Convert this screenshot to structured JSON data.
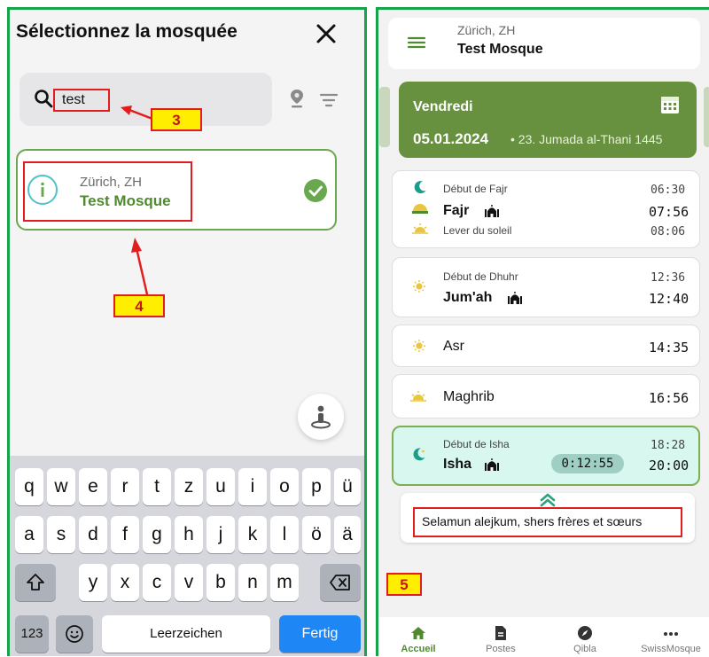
{
  "left": {
    "title": "Sélectionnez la mosquée",
    "search": {
      "value": "test"
    },
    "result": {
      "city": "Zürich, ZH",
      "name": "Test Mosque"
    },
    "keyboard": {
      "row1": [
        "q",
        "w",
        "e",
        "r",
        "t",
        "z",
        "u",
        "i",
        "o",
        "p",
        "ü"
      ],
      "row2": [
        "a",
        "s",
        "d",
        "f",
        "g",
        "h",
        "j",
        "k",
        "l",
        "ö",
        "ä"
      ],
      "row3": [
        "y",
        "x",
        "c",
        "v",
        "b",
        "n",
        "m"
      ],
      "numbers_key": "123",
      "space_key": "Leerzeichen",
      "done_key": "Fertig"
    }
  },
  "markers": {
    "m3": "3",
    "m4": "4",
    "m5": "5"
  },
  "right": {
    "header": {
      "city": "Zürich, ZH",
      "name": "Test Mosque"
    },
    "date": {
      "day": "Vendredi",
      "gregorian": "05.01.2024",
      "hijri": "• 23. Jumada al-Thani 1445"
    },
    "prayers": {
      "fajr": {
        "start_label": "Début de Fajr",
        "start_time": "06:30",
        "name": "Fajr",
        "time": "07:56",
        "sunrise_label": "Lever du soleil",
        "sunrise_time": "08:06"
      },
      "dhuhr": {
        "start_label": "Début de Dhuhr",
        "start_time": "12:36",
        "name": "Jum'ah",
        "time": "12:40"
      },
      "asr": {
        "name": "Asr",
        "time": "14:35"
      },
      "maghrib": {
        "name": "Maghrib",
        "time": "16:56"
      },
      "isha": {
        "start_label": "Début de Isha",
        "start_time": "18:28",
        "name": "Isha",
        "time": "20:00",
        "countdown": "0:12:55"
      }
    },
    "greeting": "Selamun alejkum, shers frères et sœurs",
    "nav": {
      "home": "Accueil",
      "posts": "Postes",
      "qibla": "Qibla",
      "more": "SwissMosque"
    }
  },
  "colors": {
    "accent_green": "#67913f",
    "highlight_red": "#e11d1d",
    "marker_yellow": "#ffee00",
    "panel_border": "#16a34a"
  }
}
